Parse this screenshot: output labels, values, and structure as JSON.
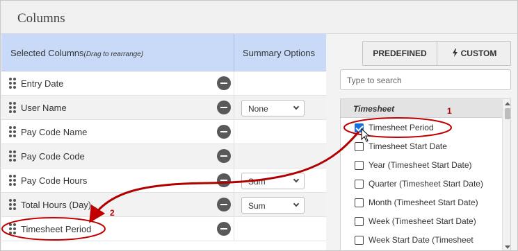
{
  "window": {
    "title": "Columns"
  },
  "table": {
    "header_selected": "Selected Columns",
    "header_selected_hint": "(Drag to rearrange)",
    "header_summary": "Summary Options",
    "rows": [
      {
        "label": "Entry Date",
        "summary": ""
      },
      {
        "label": "User Name",
        "summary": "None"
      },
      {
        "label": "Pay Code Name",
        "summary": ""
      },
      {
        "label": "Pay Code Code",
        "summary": ""
      },
      {
        "label": "Pay Code Hours",
        "summary": "Sum"
      },
      {
        "label": "Total Hours (Day)",
        "summary": "Sum"
      },
      {
        "label": "Timesheet Period",
        "summary": ""
      }
    ]
  },
  "panel": {
    "predefined_label": "PREDEFINED",
    "custom_label": "CUSTOM",
    "custom_icon": "bolt-icon",
    "search_placeholder": "Type to search",
    "group_label": "Timesheet",
    "items": [
      {
        "label": "Timesheet Period",
        "checked": true
      },
      {
        "label": "Timesheet Start Date",
        "checked": false
      },
      {
        "label": "Year (Timesheet Start Date)",
        "checked": false
      },
      {
        "label": "Quarter (Timesheet Start Date)",
        "checked": false
      },
      {
        "label": "Month (Timesheet Start Date)",
        "checked": false
      },
      {
        "label": "Week (Timesheet Start Date)",
        "checked": false
      },
      {
        "label": "Week Start Date (Timesheet",
        "checked": false
      }
    ]
  },
  "annotations": {
    "step1": "1",
    "step2": "2"
  },
  "colors": {
    "header_bg": "#c9daf8",
    "accent_checkbox": "#1a6ed8",
    "annotation": "#c00000"
  }
}
